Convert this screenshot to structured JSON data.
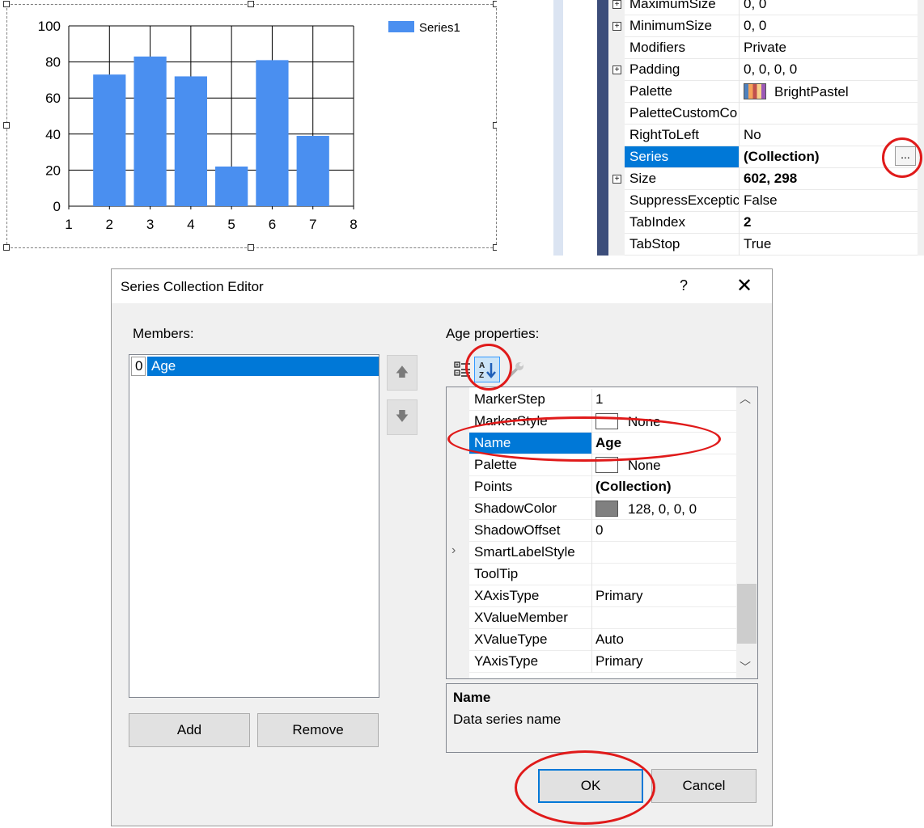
{
  "chart": {
    "legend_label": "Series1",
    "chart_data": {
      "type": "bar",
      "x": [
        2,
        3,
        4,
        5,
        6,
        7
      ],
      "values": [
        73,
        83,
        72,
        22,
        81,
        39
      ],
      "series": [
        {
          "name": "Series1",
          "values": [
            73,
            83,
            72,
            22,
            81,
            39
          ]
        }
      ],
      "xlim": [
        1,
        8
      ],
      "ylim": [
        0,
        100
      ],
      "x_ticks": [
        "1",
        "2",
        "3",
        "4",
        "5",
        "6",
        "7",
        "8"
      ],
      "y_ticks": [
        "0",
        "20",
        "40",
        "60",
        "80",
        "100"
      ],
      "grid": true,
      "legend": "top-right",
      "color": "#4a8ff0"
    }
  },
  "property_grid": {
    "rows": [
      {
        "name": "MaximumSize",
        "value": "0, 0",
        "expandable": true
      },
      {
        "name": "MinimumSize",
        "value": "0, 0",
        "expandable": true
      },
      {
        "name": "Modifiers",
        "value": "Private"
      },
      {
        "name": "Padding",
        "value": "0, 0, 0, 0",
        "expandable": true
      },
      {
        "name": "Palette",
        "value": "BrightPastel"
      },
      {
        "name": "PaletteCustomCo",
        "value": ""
      },
      {
        "name": "RightToLeft",
        "value": "No"
      },
      {
        "name": "Series",
        "value": "(Collection)",
        "selected": true
      },
      {
        "name": "Size",
        "value": "602, 298",
        "expandable": true
      },
      {
        "name": "SuppressExceptic",
        "value": "False"
      },
      {
        "name": "TabIndex",
        "value": "2"
      },
      {
        "name": "TabStop",
        "value": "True"
      }
    ],
    "ellipsis_label": "..."
  },
  "dialog": {
    "title": "Series Collection Editor",
    "help": "?",
    "close": "✕",
    "members_label": "Members:",
    "member_index": "0",
    "member_name": "Age",
    "properties_label": "Age properties:",
    "up_arrow": "🡅",
    "down_arrow": "🡇",
    "add_label": "Add",
    "remove_label": "Remove",
    "ok_label": "OK",
    "cancel_label": "Cancel",
    "properties": [
      {
        "name": "MarkerStep",
        "value": "1"
      },
      {
        "name": "MarkerStyle",
        "value": "None",
        "swatch": "#ffffff"
      },
      {
        "name": "Name",
        "value": "Age",
        "selected": true
      },
      {
        "name": "Palette",
        "value": "None",
        "swatch": "#ffffff"
      },
      {
        "name": "Points",
        "value": "(Collection)"
      },
      {
        "name": "ShadowColor",
        "value": "128, 0, 0, 0",
        "swatch": "#808080"
      },
      {
        "name": "ShadowOffset",
        "value": "0"
      },
      {
        "name": "SmartLabelStyle",
        "value": "",
        "expandable": true
      },
      {
        "name": "ToolTip",
        "value": ""
      },
      {
        "name": "XAxisType",
        "value": "Primary"
      },
      {
        "name": "XValueMember",
        "value": ""
      },
      {
        "name": "XValueType",
        "value": "Auto"
      },
      {
        "name": "YAxisType",
        "value": "Primary"
      }
    ],
    "description_title": "Name",
    "description_text": "Data series name"
  }
}
